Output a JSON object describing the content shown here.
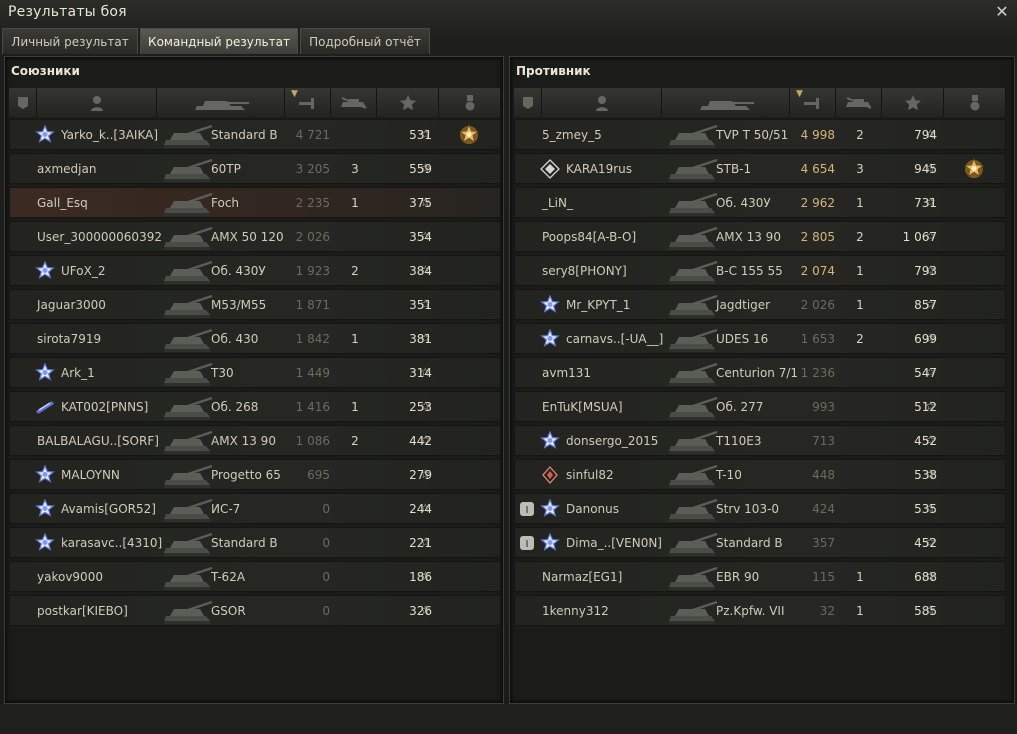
{
  "window": {
    "title": "Результаты боя"
  },
  "tabs": [
    {
      "label": "Личный результат"
    },
    {
      "label": "Командный результат"
    },
    {
      "label": "Подробный отчёт"
    }
  ],
  "active_tab": 1,
  "allies": {
    "title": "Союзники",
    "rows": [
      {
        "name": "Yarko_k..[3AIKA]",
        "vehicle": "Standard B",
        "damage": "4 721",
        "kills": "",
        "xp": "531",
        "badge": "",
        "icon": "star",
        "medal": true,
        "hl": false
      },
      {
        "name": "axmedjan",
        "vehicle": "60TP",
        "damage": "3 205",
        "kills": "3",
        "xp": "559",
        "badge": "",
        "icon": "",
        "medal": false,
        "hl": false
      },
      {
        "name": "Gall_Esq",
        "vehicle": "Foch",
        "damage": "2 235",
        "kills": "1",
        "xp": "375",
        "badge": "",
        "icon": "",
        "medal": false,
        "hl": true
      },
      {
        "name": "User_300000060392",
        "vehicle": "AMX 50 120",
        "damage": "2 026",
        "kills": "",
        "xp": "354",
        "badge": "",
        "icon": "",
        "medal": false,
        "hl": false
      },
      {
        "name": "UFoX_2",
        "vehicle": "Об. 430У",
        "damage": "1 923",
        "kills": "2",
        "xp": "384",
        "badge": "",
        "icon": "star",
        "medal": false,
        "hl": false
      },
      {
        "name": "Jaguar3000",
        "vehicle": "M53/M55",
        "damage": "1 871",
        "kills": "",
        "xp": "351",
        "badge": "",
        "icon": "",
        "medal": false,
        "hl": false
      },
      {
        "name": "sirota7919",
        "vehicle": "Об. 430",
        "damage": "1 842",
        "kills": "1",
        "xp": "381",
        "badge": "",
        "icon": "",
        "medal": false,
        "hl": false
      },
      {
        "name": "Ark_1",
        "vehicle": "T30",
        "damage": "1 449",
        "kills": "",
        "xp": "314",
        "badge": "",
        "icon": "star",
        "medal": false,
        "hl": false
      },
      {
        "name": "KAT002[PNNS]",
        "vehicle": "Об. 268",
        "damage": "1 416",
        "kills": "1",
        "xp": "253",
        "badge": "",
        "icon": "flag",
        "medal": false,
        "hl": false
      },
      {
        "name": "BALBALAGU..[SORF]",
        "vehicle": "AMX 13 90",
        "damage": "1 086",
        "kills": "2",
        "xp": "442",
        "badge": "",
        "icon": "",
        "medal": false,
        "hl": false
      },
      {
        "name": "MALOYNN",
        "vehicle": "Progetto 65",
        "damage": "695",
        "kills": "",
        "xp": "279",
        "badge": "",
        "icon": "star",
        "medal": false,
        "hl": false
      },
      {
        "name": "Avamis[GOR52]",
        "vehicle": "ИС-7",
        "damage": "0",
        "kills": "",
        "xp": "244",
        "badge": "",
        "icon": "star",
        "medal": false,
        "hl": false
      },
      {
        "name": "karasavc..[4310]",
        "vehicle": "Standard B",
        "damage": "0",
        "kills": "",
        "xp": "221",
        "badge": "",
        "icon": "star",
        "medal": false,
        "hl": false
      },
      {
        "name": "yakov9000",
        "vehicle": "T-62A",
        "damage": "0",
        "kills": "",
        "xp": "186",
        "badge": "",
        "icon": "",
        "medal": false,
        "hl": false
      },
      {
        "name": "postkar[KIEBO]",
        "vehicle": "GSOR",
        "damage": "0",
        "kills": "",
        "xp": "326",
        "badge": "",
        "icon": "",
        "medal": false,
        "hl": false
      }
    ]
  },
  "enemies": {
    "title": "Противник",
    "rows": [
      {
        "name": "5_zmey_5",
        "vehicle": "TVP T 50/51",
        "damage": "4 998",
        "kills": "2",
        "xp": "794",
        "badge": "",
        "icon": "",
        "medal": false,
        "hi": true
      },
      {
        "name": "KARA19rus",
        "vehicle": "STB-1",
        "damage": "4 654",
        "kills": "3",
        "xp": "945",
        "badge": "",
        "icon": "diamond",
        "medal": true,
        "hi": true
      },
      {
        "name": "_LiN_",
        "vehicle": "Об. 430У",
        "damage": "2 962",
        "kills": "1",
        "xp": "731",
        "badge": "",
        "icon": "",
        "medal": false,
        "hi": true
      },
      {
        "name": "Poops84[A-B-O]",
        "vehicle": "AMX 13 90",
        "damage": "2 805",
        "kills": "2",
        "xp": "1 067",
        "badge": "",
        "icon": "",
        "medal": false,
        "hi": true
      },
      {
        "name": "sery8[PHONY]",
        "vehicle": "B-C 155 55",
        "damage": "2 074",
        "kills": "1",
        "xp": "793",
        "badge": "",
        "icon": "",
        "medal": false,
        "hi": true
      },
      {
        "name": "Mr_KPYT_1",
        "vehicle": "Jagdtiger",
        "damage": "2 026",
        "kills": "1",
        "xp": "857",
        "badge": "",
        "icon": "star",
        "medal": false,
        "hi": false
      },
      {
        "name": "carnavs..[-UA__]",
        "vehicle": "UDES 16",
        "damage": "1 653",
        "kills": "2",
        "xp": "699",
        "badge": "",
        "icon": "star",
        "medal": false,
        "hi": false
      },
      {
        "name": "avm131",
        "vehicle": "Centurion 7/1",
        "damage": "1 236",
        "kills": "",
        "xp": "547",
        "badge": "",
        "icon": "",
        "medal": false,
        "hi": false
      },
      {
        "name": "EnTuK[MSUA]",
        "vehicle": "Об. 277",
        "damage": "993",
        "kills": "",
        "xp": "512",
        "badge": "",
        "icon": "",
        "medal": false,
        "hi": false
      },
      {
        "name": "donsergo_2015",
        "vehicle": "T110E3",
        "damage": "713",
        "kills": "",
        "xp": "452",
        "badge": "",
        "icon": "star",
        "medal": false,
        "hi": false
      },
      {
        "name": "sinful82",
        "vehicle": "T-10",
        "damage": "448",
        "kills": "",
        "xp": "538",
        "badge": "",
        "icon": "diamond2",
        "medal": false,
        "hi": false
      },
      {
        "name": "Danonus",
        "vehicle": "Strv 103-0",
        "damage": "424",
        "kills": "",
        "xp": "535",
        "badge": "I",
        "icon": "star",
        "medal": false,
        "hi": false
      },
      {
        "name": "Dima_..[VEN0N]",
        "vehicle": "Standard B",
        "damage": "357",
        "kills": "",
        "xp": "452",
        "badge": "I",
        "icon": "star",
        "medal": false,
        "hi": false
      },
      {
        "name": "Narmaz[EG1]",
        "vehicle": "EBR 90",
        "damage": "115",
        "kills": "1",
        "xp": "688",
        "badge": "",
        "icon": "",
        "medal": false,
        "hi": false
      },
      {
        "name": "1kenny312",
        "vehicle": "Pz.Kpfw. VII",
        "damage": "32",
        "kills": "1",
        "xp": "585",
        "badge": "",
        "icon": "",
        "medal": false,
        "hi": false
      }
    ]
  },
  "star_glyph": "☆"
}
